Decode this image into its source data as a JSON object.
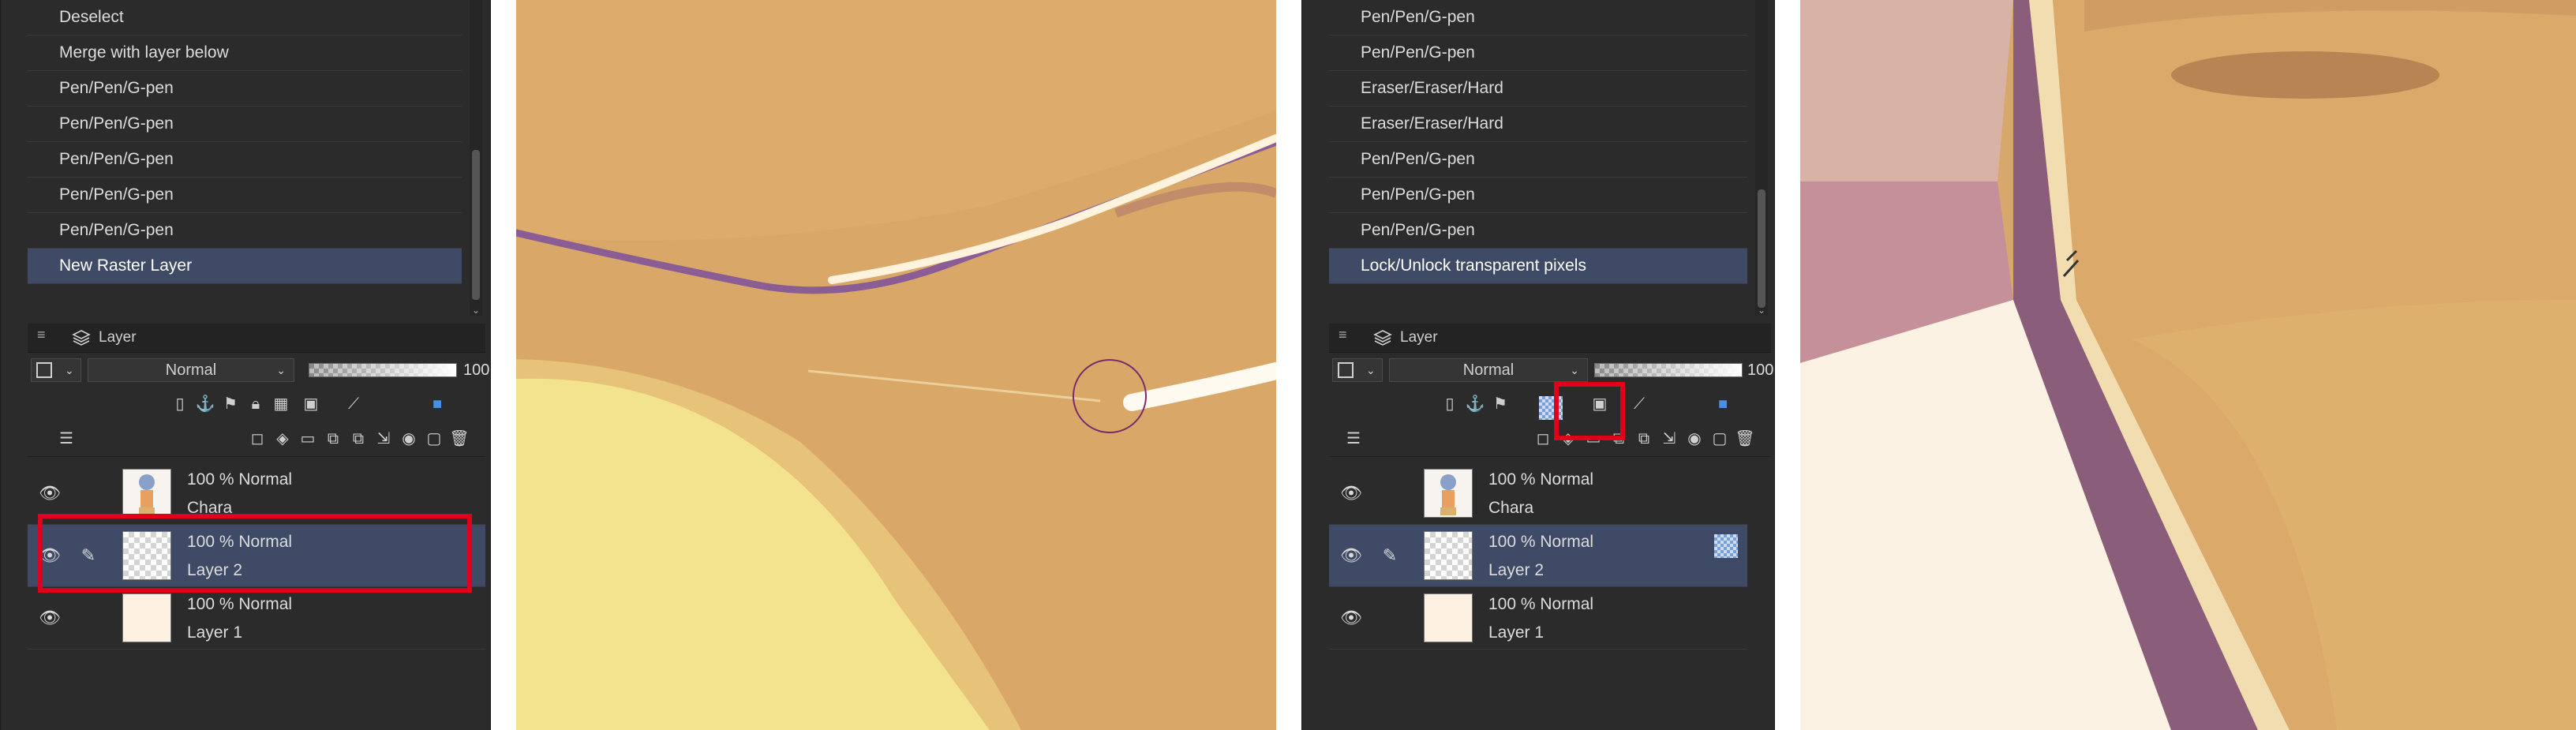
{
  "left_panel": {
    "history": [
      "Deselect",
      "Merge with layer below",
      "Pen/Pen/G-pen",
      "Pen/Pen/G-pen",
      "Pen/Pen/G-pen",
      "Pen/Pen/G-pen",
      "Pen/Pen/G-pen",
      "New Raster Layer"
    ],
    "selected_history_index": 7,
    "layer_tab_label": "Layer",
    "blend_mode": "Normal",
    "opacity_value": "100",
    "layers": [
      {
        "line1": "100 % Normal",
        "line2": "Chara",
        "thumb": "chara"
      },
      {
        "line1": "100 % Normal",
        "line2": "Layer 2",
        "thumb": "transparent"
      },
      {
        "line1": "100 % Normal",
        "line2": "Layer 1",
        "thumb": "cream"
      }
    ],
    "selected_layer_index": 1
  },
  "right_panel": {
    "history": [
      "Pen/Pen/G-pen",
      "Pen/Pen/G-pen",
      "Eraser/Eraser/Hard",
      "Eraser/Eraser/Hard",
      "Pen/Pen/G-pen",
      "Pen/Pen/G-pen",
      "Pen/Pen/G-pen",
      "Lock/Unlock transparent pixels"
    ],
    "selected_history_index": 7,
    "layer_tab_label": "Layer",
    "blend_mode": "Normal",
    "opacity_value": "100",
    "layers": [
      {
        "line1": "100 % Normal",
        "line2": "Chara",
        "thumb": "chara"
      },
      {
        "line1": "100 % Normal",
        "line2": "Layer 2",
        "thumb": "transparent"
      },
      {
        "line1": "100 % Normal",
        "line2": "Layer 1",
        "thumb": "cream"
      }
    ],
    "selected_layer_index": 1
  },
  "colors": {
    "panel_bg": "#2b2b2b",
    "selection": "#3e4a66",
    "highlight_red": "#e0001b",
    "canvas_tan": "#d9a868",
    "canvas_yellow": "#f3e38e",
    "line_purple": "#8a5d95"
  },
  "icons": [
    "eye-icon",
    "pen-icon",
    "lock-transparent-icon",
    "layers-icon",
    "brush-cursor-icon",
    "eyedropper-cursor-icon"
  ]
}
